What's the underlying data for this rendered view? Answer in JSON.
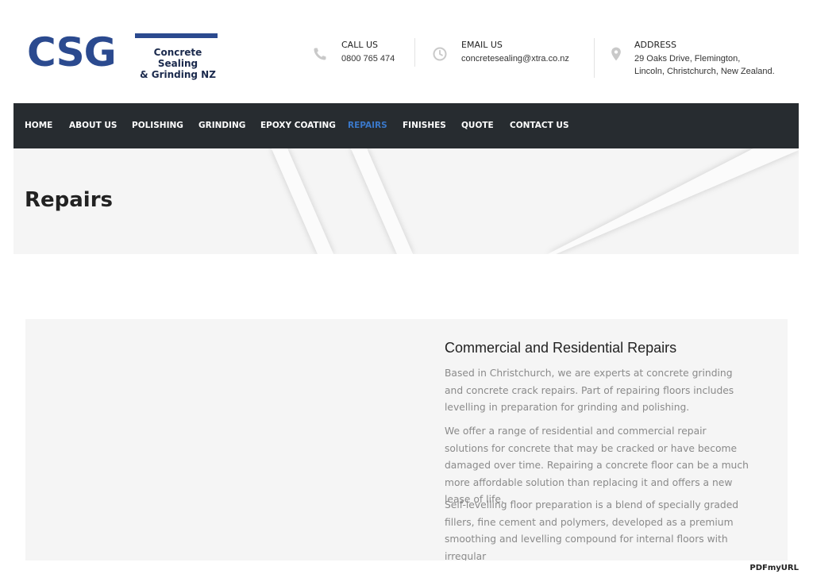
{
  "logo": {
    "letters": "CSG",
    "line1": "Concrete Sealing",
    "line2": "& Grinding NZ"
  },
  "contacts": {
    "call": {
      "label": "CALL US",
      "value": "0800 765 474",
      "icon": "phone-icon"
    },
    "email": {
      "label": "EMAIL US",
      "value": "concretesealing@xtra.co.nz",
      "icon": "clock-icon"
    },
    "address": {
      "label": "ADDRESS",
      "line1": "29 Oaks Drive, Flemington,",
      "line2": "Lincoln, Christchurch, New Zealand.",
      "icon": "map-pin-icon"
    }
  },
  "nav": {
    "items": [
      "HOME",
      "ABOUT US",
      "POLISHING",
      "GRINDING",
      "EPOXY COATING",
      "REPAIRS",
      "FINISHES",
      "QUOTE",
      "CONTACT US"
    ],
    "active": "REPAIRS"
  },
  "page": {
    "title": "Repairs"
  },
  "section": {
    "heading": "Commercial and Residential Repairs",
    "paragraphs": [
      "Based in Christchurch, we are experts at concrete grinding and concrete crack repairs. Part of repairing floors includes levelling in preparation for grinding and polishing.",
      "We offer a range of residential and commercial repair solutions for concrete that may be cracked or have become damaged over time. Repairing a concrete floor can be a much more affordable solution than replacing it and offers a new lease of life.",
      "Self-levelling floor preparation is a blend of specially graded fillers, fine cement and polymers, developed as a premium smoothing and levelling compound for internal floors with irregular"
    ]
  },
  "watermark": "PDFmyURL",
  "colors": {
    "brand": "#2b4a8f",
    "nav_bg": "#272c30",
    "nav_active": "#3a78c9",
    "band_bg": "#f5f5f5"
  }
}
